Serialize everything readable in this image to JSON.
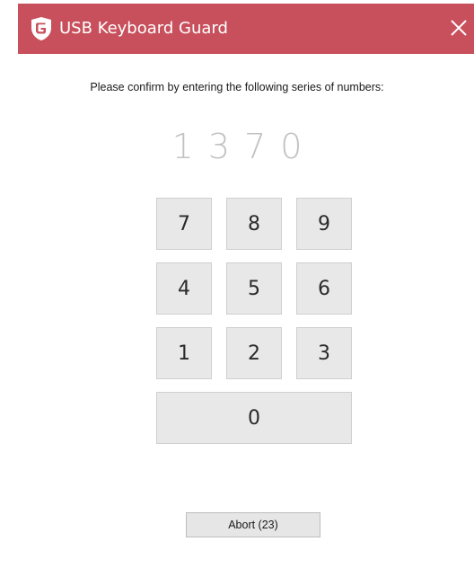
{
  "window": {
    "title": "USB Keyboard Guard",
    "accent_color": "#c8505c",
    "logo_icon": "g-data-shield-icon",
    "close_icon": "close-icon"
  },
  "prompt": {
    "text": "Please confirm by entering the following series of numbers:"
  },
  "code": {
    "digits": [
      "1",
      "3",
      "7",
      "0"
    ]
  },
  "keypad": {
    "keys": [
      "7",
      "8",
      "9",
      "4",
      "5",
      "6",
      "1",
      "2",
      "3",
      "0"
    ]
  },
  "abort": {
    "label": "Abort (23)"
  }
}
